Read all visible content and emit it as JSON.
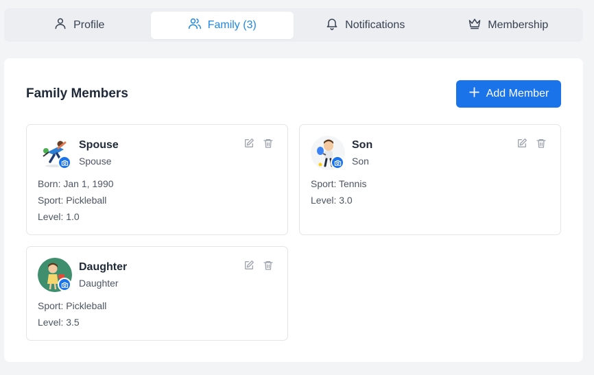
{
  "tabs": [
    {
      "label": "Profile",
      "icon": "user-icon",
      "active": false
    },
    {
      "label": "Family (3)",
      "icon": "users-icon",
      "active": true
    },
    {
      "label": "Notifications",
      "icon": "bell-icon",
      "active": false
    },
    {
      "label": "Membership",
      "icon": "crown-icon",
      "active": false
    }
  ],
  "panel": {
    "title": "Family Members",
    "add_button_label": "Add Member"
  },
  "members": [
    {
      "name": "Spouse",
      "relation": "Spouse",
      "details": [
        "Born: Jan 1, 1990",
        "Sport: Pickleball",
        "Level: 1.0"
      ]
    },
    {
      "name": "Son",
      "relation": "Son",
      "details": [
        "Sport: Tennis",
        "Level: 3.0"
      ]
    },
    {
      "name": "Daughter",
      "relation": "Daughter",
      "details": [
        "Sport: Pickleball",
        "Level: 3.5"
      ]
    }
  ],
  "colors": {
    "accent": "#1a73e8",
    "active_tab_text": "#1e88e5"
  }
}
